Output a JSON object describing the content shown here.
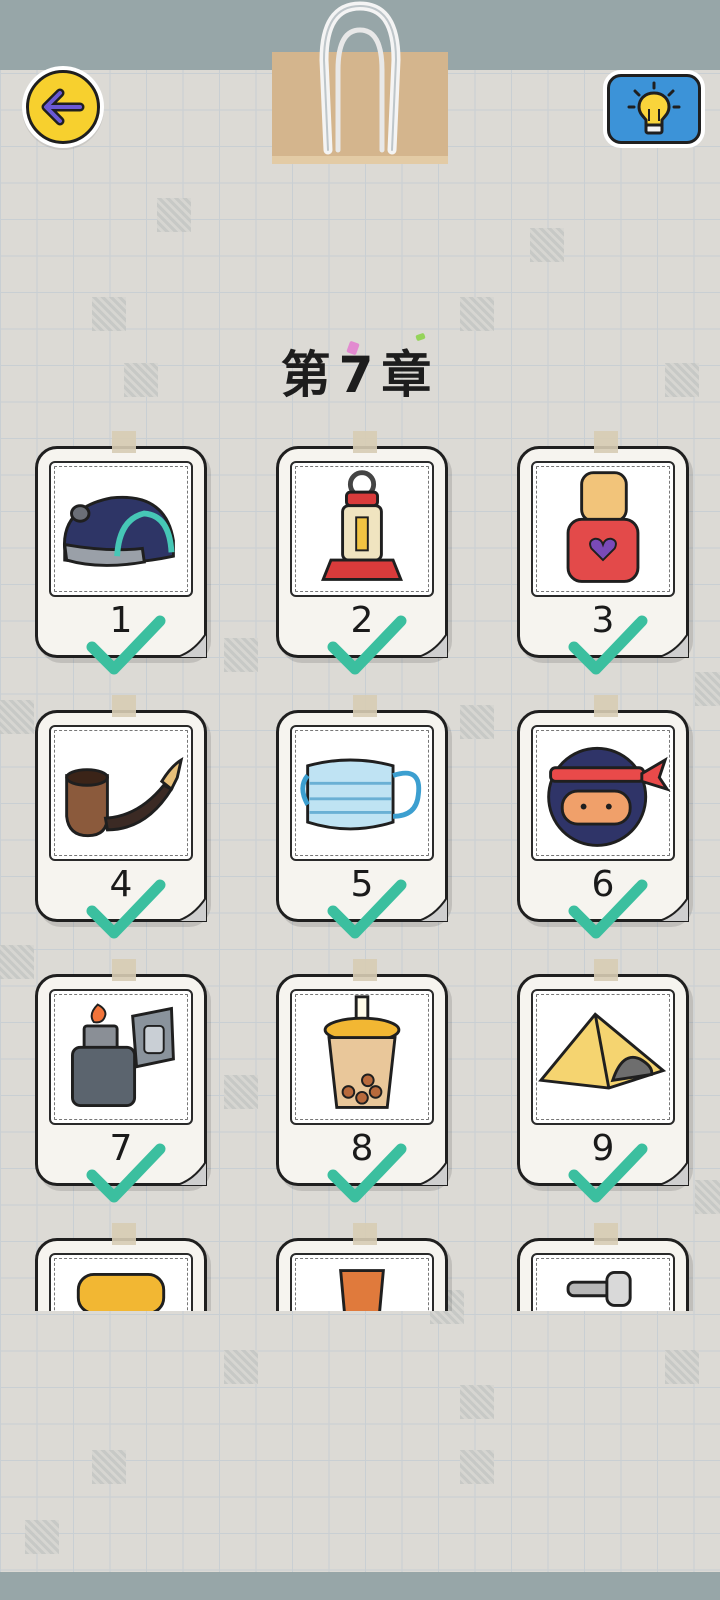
{
  "chapter": {
    "title": "第7章"
  },
  "buttons": {
    "back_icon": "back-arrow-icon",
    "hint_icon": "lightbulb-icon"
  },
  "colors": {
    "back_button": "#f7d02e",
    "hint_button": "#3c93d8",
    "checkmark": "#3bbf9f",
    "top_bar": "#97a6a8"
  },
  "levels": [
    {
      "number": "1",
      "item": "computer-mouse-icon",
      "completed": true
    },
    {
      "number": "2",
      "item": "lantern-icon",
      "completed": true
    },
    {
      "number": "3",
      "item": "nail-polish-icon",
      "completed": true
    },
    {
      "number": "4",
      "item": "tobacco-pipe-icon",
      "completed": true
    },
    {
      "number": "5",
      "item": "face-mask-icon",
      "completed": true
    },
    {
      "number": "6",
      "item": "ninja-icon",
      "completed": true
    },
    {
      "number": "7",
      "item": "lighter-icon",
      "completed": true
    },
    {
      "number": "8",
      "item": "bubble-tea-icon",
      "completed": true
    },
    {
      "number": "9",
      "item": "tent-icon",
      "completed": true
    },
    {
      "item": "jar-lid-icon"
    },
    {
      "item": "flower-pot-icon"
    },
    {
      "item": "faucet-icon"
    }
  ]
}
